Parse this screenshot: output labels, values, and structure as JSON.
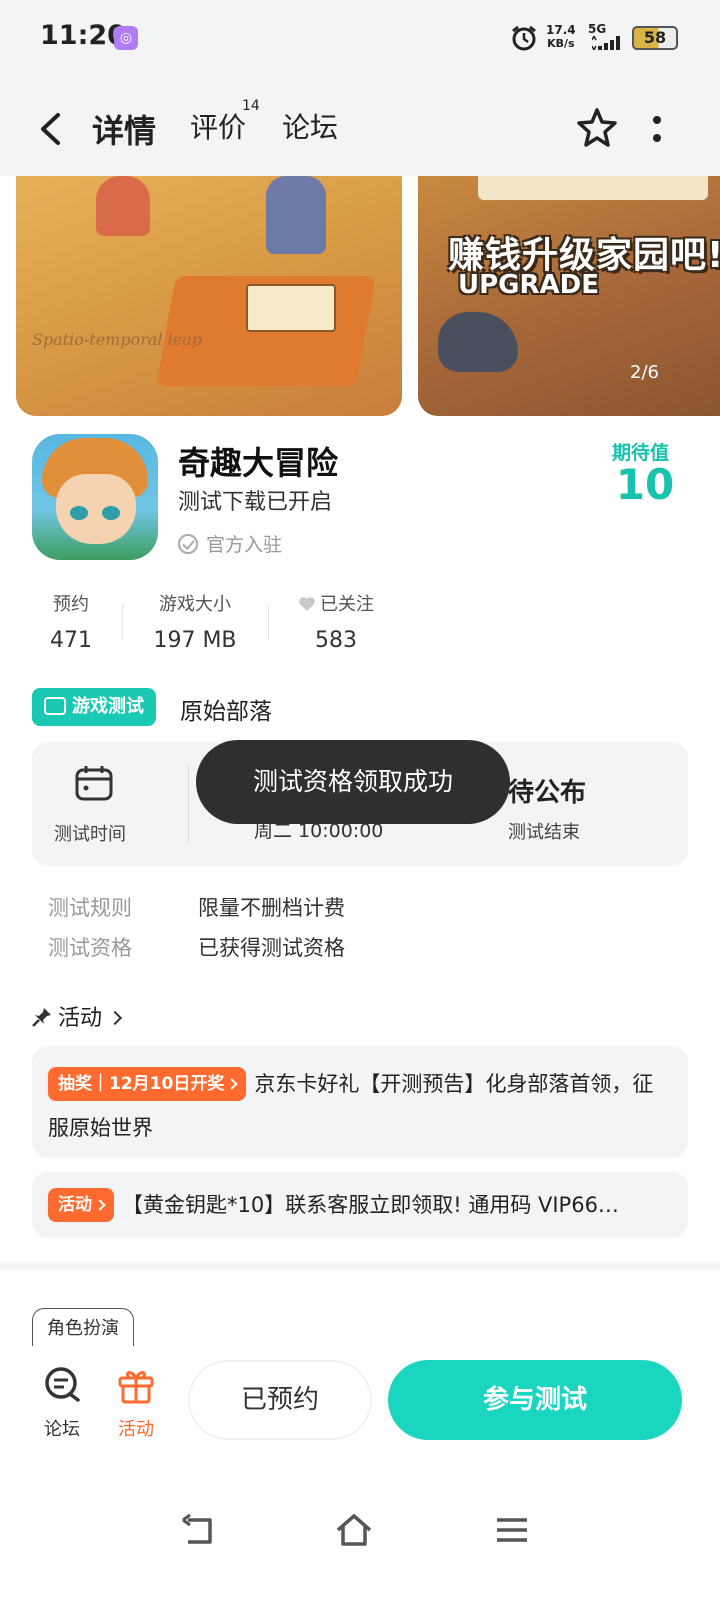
{
  "status_bar": {
    "time": "11:20",
    "net_speed_value": "17.4",
    "net_speed_unit": "KB/s",
    "network": "5G",
    "battery": "58"
  },
  "nav": {
    "tabs": [
      "详情",
      "评价",
      "论坛"
    ],
    "review_count": "14"
  },
  "banner": {
    "slide2_title": "赚钱升级家园吧!",
    "slide2_subtitle": "UPGRADE",
    "slide1_caption": "Spatio-temporal leap",
    "counter": "2/6"
  },
  "app": {
    "name": "奇趣大冒险",
    "status": "测试下载已开启",
    "official": "官方入驻",
    "expect_label": "期待值",
    "expect_value": "10"
  },
  "stats": [
    {
      "label": "预约",
      "value": "471"
    },
    {
      "label": "游戏大小",
      "value": "197 MB"
    },
    {
      "label": "已关注",
      "value": "583"
    }
  ],
  "test": {
    "badge": "游戏测试",
    "tribe": "原始部落",
    "time_label": "测试时间",
    "date_partial": "周二  10:00:00",
    "end_title": "待公布",
    "end_label": "测试结束",
    "rules": [
      {
        "label": "测试规则",
        "value": "限量不删档计费"
      },
      {
        "label": "测试资格",
        "value": "已获得测试资格"
      }
    ]
  },
  "toast": "测试资格领取成功",
  "activities": {
    "heading": "活动",
    "items": [
      {
        "pill": "抽奖｜12月10日开奖",
        "text": "京东卡好礼【开测预告】化身部落首领，征服原始世界"
      },
      {
        "pill": "活动",
        "text": "【黄金钥匙*10】联系客服立即领取! 通用码 VIP66…"
      }
    ]
  },
  "tag": "角色扮演",
  "action_bar": {
    "forum": "论坛",
    "activity": "活动",
    "reserved": "已预约",
    "join": "参与测试"
  },
  "colors": {
    "accent": "#19d3be",
    "orange": "#ff6a2e",
    "toast_bg": "#2f2f2f"
  }
}
